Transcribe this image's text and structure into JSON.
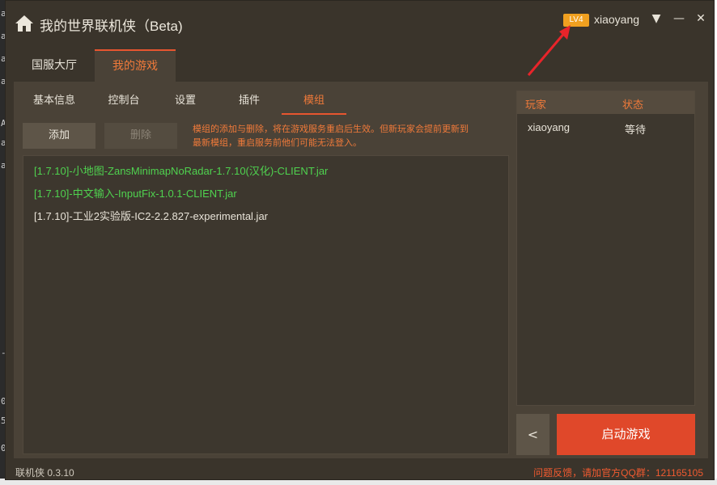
{
  "app": {
    "title": "我的世界联机侠（Beta)",
    "level_badge": "LV4",
    "username": "xiaoyang",
    "dropdown_glyph": "▼",
    "minimize_glyph": "—",
    "close_glyph": "✕"
  },
  "main_tabs": [
    {
      "label": "国服大厅",
      "active": false
    },
    {
      "label": "我的游戏",
      "active": true
    }
  ],
  "sub_tabs": [
    {
      "label": "基本信息",
      "active": false
    },
    {
      "label": "控制台",
      "active": false
    },
    {
      "label": "设置",
      "active": false
    },
    {
      "label": "插件",
      "active": false
    },
    {
      "label": "模组",
      "active": true
    }
  ],
  "mods_toolbar": {
    "add_label": "添加",
    "delete_label": "删除",
    "notice_line1": "模组的添加与删除，将在游戏服务重启后生效。但新玩家会提前更新到",
    "notice_line2": "最新模组，重启服务前他们可能无法登入。"
  },
  "mods": [
    {
      "name": "[1.7.10]-小地图-ZansMinimapNoRadar-1.7.10(汉化)-CLIENT.jar",
      "color": "#4fd24f"
    },
    {
      "name": "[1.7.10]-中文输入-InputFix-1.0.1-CLIENT.jar",
      "color": "#4fd24f"
    },
    {
      "name": "[1.7.10]-工业2实验版-IC2-2.2.827-experimental.jar",
      "color": "#e8e3d8"
    }
  ],
  "players_panel": {
    "col_player": "玩家",
    "col_status": "状态",
    "rows": [
      {
        "player": "xiaoyang",
        "status": "等待"
      }
    ]
  },
  "actions": {
    "back_glyph": "<",
    "start_label": "启动游戏"
  },
  "footer": {
    "version": "联机侠 0.3.10",
    "feedback": "问题反馈，请加官方QQ群：121165105"
  },
  "colors": {
    "accent": "#e8552f",
    "accent_text": "#f07a3a",
    "level_badge": "#f0a020",
    "window_bg": "#3a342b",
    "panel_bg": "#4a4237"
  },
  "icons": {
    "home": "home-icon",
    "annotation": "red-arrow-icon"
  }
}
